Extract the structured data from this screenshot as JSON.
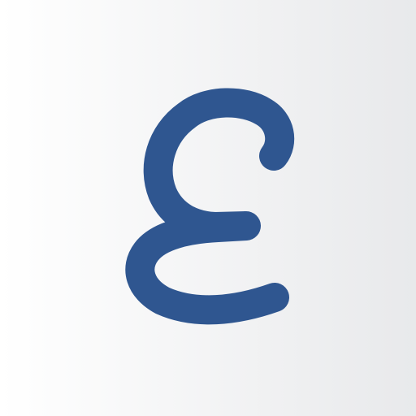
{
  "icon": {
    "logo_letter": "E",
    "logo_color": "#2f5690",
    "background_gradient": {
      "start_color": "#ffffff",
      "end_color": "#e8e9eb"
    }
  }
}
